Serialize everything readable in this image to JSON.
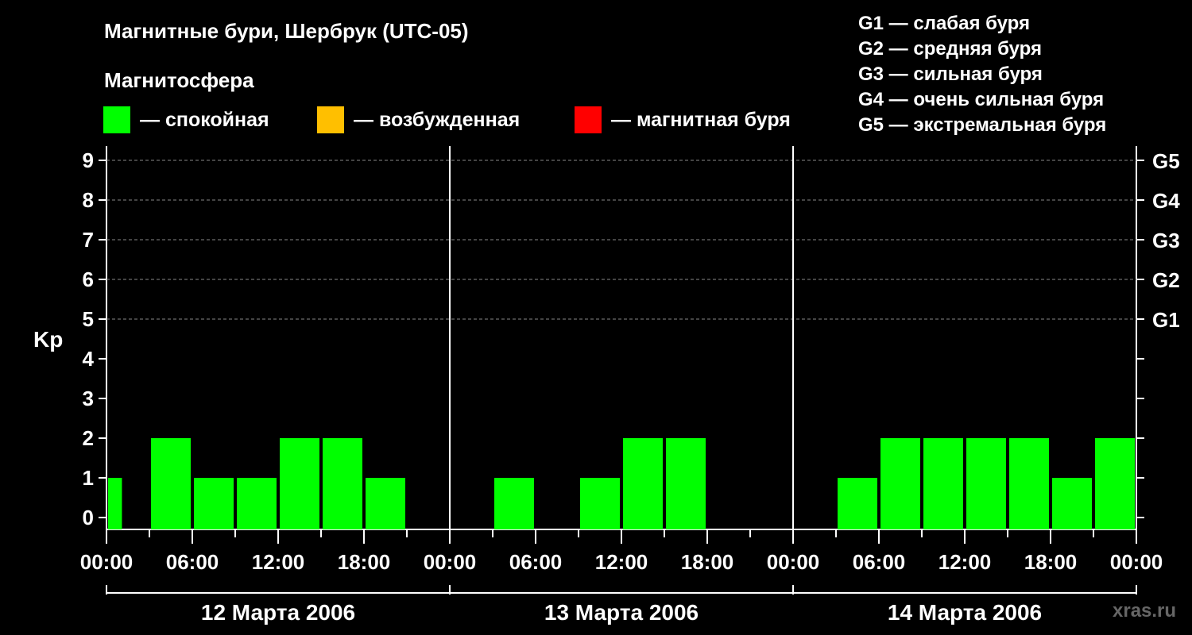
{
  "title": "Магнитные бури, Шербрук (UTC-05)",
  "subtitle": "Магнитосфера",
  "legend": [
    {
      "label": "— спокойная",
      "color": "#00ff00"
    },
    {
      "label": "— возбужденная",
      "color": "#ffbf00"
    },
    {
      "label": "— магнитная буря",
      "color": "#ff0000"
    }
  ],
  "g_legend": [
    "G1 — слабая буря",
    "G2 — средняя буря",
    "G3 — сильная буря",
    "G4 — очень сильная буря",
    "G5 — экстремальная буря"
  ],
  "watermark": "xras.ru",
  "chart_data": {
    "type": "bar",
    "ylabel": "Kp",
    "ylim": [
      0,
      9
    ],
    "y_ticks": [
      "0",
      "1",
      "2",
      "3",
      "4",
      "5",
      "6",
      "7",
      "8",
      "9"
    ],
    "right_ticks": [
      {
        "kp": 5,
        "label": "G1"
      },
      {
        "kp": 6,
        "label": "G2"
      },
      {
        "kp": 7,
        "label": "G3"
      },
      {
        "kp": 8,
        "label": "G4"
      },
      {
        "kp": 9,
        "label": "G5"
      }
    ],
    "x_tick_labels": [
      "00:00",
      "06:00",
      "12:00",
      "18:00",
      "00:00",
      "06:00",
      "12:00",
      "18:00",
      "00:00",
      "06:00",
      "12:00",
      "18:00",
      "00:00"
    ],
    "days": [
      "12 Марта 2006",
      "13 Марта 2006",
      "14 Марта 2006"
    ],
    "grid": true,
    "bar_color": "#00ff00",
    "series": [
      {
        "values": [
          1,
          2,
          1,
          1,
          2,
          2,
          1,
          0
        ]
      },
      {
        "values": [
          0,
          1,
          0,
          1,
          2,
          2,
          0,
          0
        ]
      },
      {
        "values": [
          0,
          1,
          2,
          2,
          2,
          2,
          1,
          2
        ]
      }
    ]
  }
}
